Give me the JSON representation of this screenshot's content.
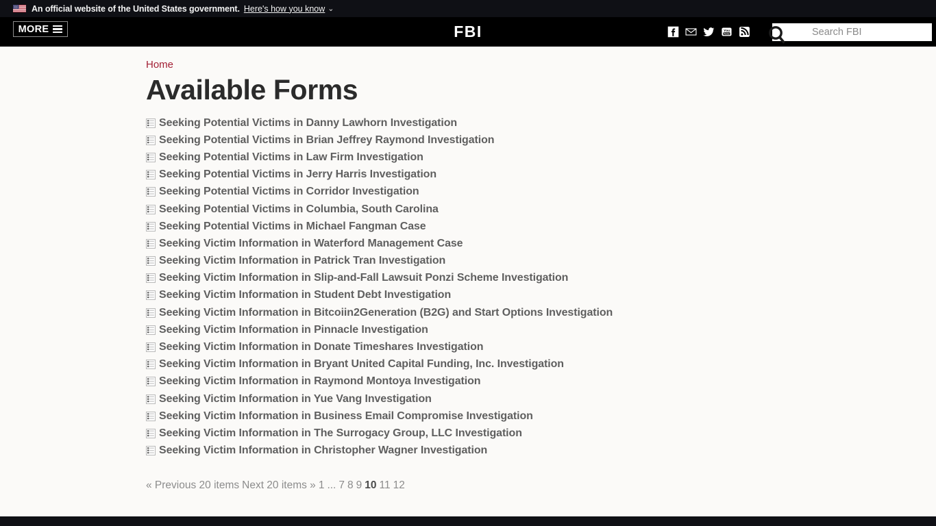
{
  "gov_banner": {
    "flag_icon": "us-flag-icon",
    "text": "An official website of the United States government.",
    "link_label": "Here's how you know",
    "chevron": "⌄"
  },
  "header": {
    "more_label": "MORE",
    "menu_icon": "hamburger-icon",
    "logo": "FBI",
    "social": [
      {
        "name": "facebook-icon",
        "label": "Facebook"
      },
      {
        "name": "email-icon",
        "label": "Email"
      },
      {
        "name": "twitter-icon",
        "label": "Twitter"
      },
      {
        "name": "youtube-icon",
        "label": "YouTube"
      },
      {
        "name": "rss-icon",
        "label": "RSS"
      }
    ],
    "search": {
      "icon": "search-icon",
      "placeholder": "Search FBI",
      "value": ""
    }
  },
  "breadcrumb": {
    "items": [
      "Home"
    ]
  },
  "page": {
    "title": "Available Forms"
  },
  "forms": [
    {
      "icon": "form-document-icon",
      "title": "Seeking Potential Victims in Danny Lawhorn Investigation"
    },
    {
      "icon": "form-document-icon",
      "title": "Seeking Potential Victims in Brian Jeffrey Raymond Investigation"
    },
    {
      "icon": "form-document-icon",
      "title": "Seeking Potential Victims in Law Firm Investigation"
    },
    {
      "icon": "form-document-icon",
      "title": "Seeking Potential Victims in Jerry Harris Investigation"
    },
    {
      "icon": "form-document-icon",
      "title": "Seeking Potential Victims in Corridor Investigation"
    },
    {
      "icon": "form-document-icon",
      "title": "Seeking Potential Victims in Columbia, South Carolina"
    },
    {
      "icon": "form-document-icon",
      "title": "Seeking Potential Victims in Michael Fangman Case"
    },
    {
      "icon": "form-document-icon",
      "title": "Seeking Victim Information in Waterford Management Case"
    },
    {
      "icon": "form-document-icon",
      "title": "Seeking Victim Information in Patrick Tran Investigation"
    },
    {
      "icon": "form-document-icon",
      "title": "Seeking Victim Information in Slip-and-Fall Lawsuit Ponzi Scheme Investigation"
    },
    {
      "icon": "form-document-icon",
      "title": "Seeking Victim Information in Student Debt Investigation"
    },
    {
      "icon": "form-document-icon",
      "title": "Seeking Victim Information in Bitcoiin2Generation (B2G) and Start Options Investigation"
    },
    {
      "icon": "form-document-icon",
      "title": "Seeking Victim Information in Pinnacle Investigation"
    },
    {
      "icon": "form-document-icon",
      "title": "Seeking Victim Information in Donate Timeshares Investigation"
    },
    {
      "icon": "form-document-icon",
      "title": "Seeking Victim Information in Bryant United Capital Funding, Inc. Investigation"
    },
    {
      "icon": "form-document-icon",
      "title": "Seeking Victim Information in Raymond Montoya Investigation"
    },
    {
      "icon": "form-document-icon",
      "title": "Seeking Victim Information in Yue Vang Investigation"
    },
    {
      "icon": "form-document-icon",
      "title": "Seeking Victim Information in Business Email Compromise Investigation"
    },
    {
      "icon": "form-document-icon",
      "title": "Seeking Victim Information in The Surrogacy Group, LLC Investigation"
    },
    {
      "icon": "form-document-icon",
      "title": "Seeking Victim Information in Christopher Wagner Investigation"
    }
  ],
  "pagination": {
    "previous_label": "« Previous 20 items",
    "next_label": "Next 20 items »",
    "first_page": "1",
    "ellipsis": "...",
    "pages": [
      "7",
      "8",
      "9",
      "10",
      "11",
      "12"
    ],
    "current_page": "10"
  },
  "colors": {
    "banner_bg": "#0f1015",
    "header_bg": "#000000",
    "body_bg": "#fbfaf8",
    "breadcrumb_link": "#a32035",
    "title": "#2b2b2b",
    "list_link": "#5f5f5f",
    "pagination": "#8c8c8c"
  }
}
